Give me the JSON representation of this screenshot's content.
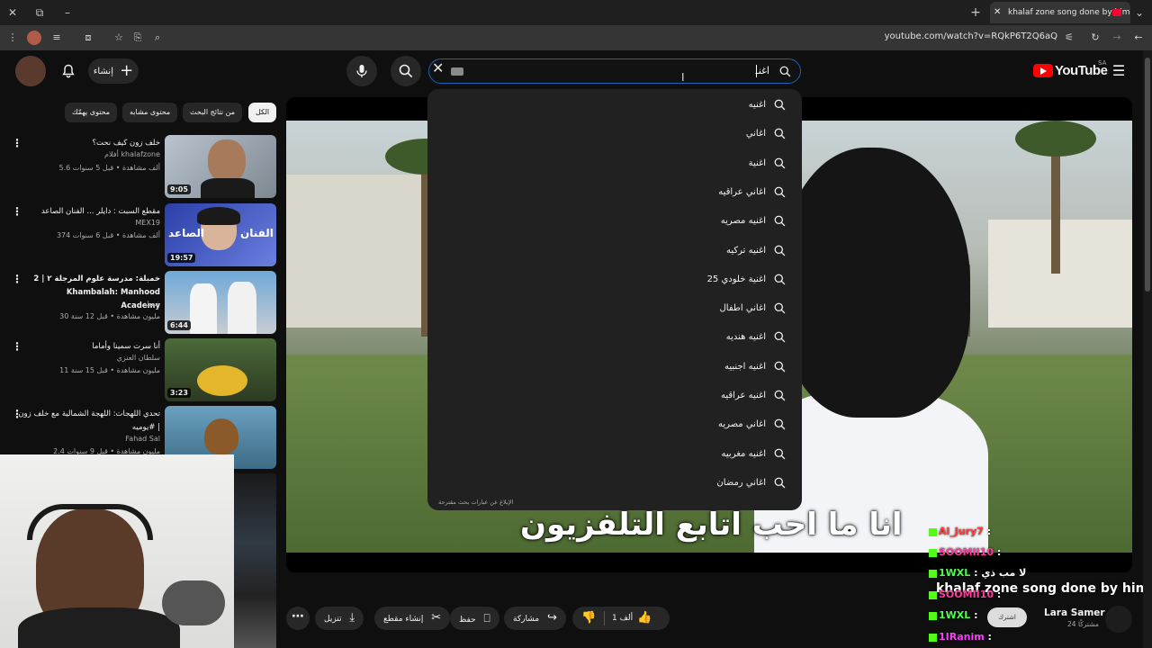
{
  "browser": {
    "active_tab_title": "khalaf zone song done by him",
    "url": "youtube.com/watch?v=RQkP6T2Q6aQ"
  },
  "header": {
    "create_label": "إنشاء",
    "search_query": "اغنـ",
    "logo_text": "YouTube",
    "country_code": "SA"
  },
  "chips": [
    "الكل",
    "من نتائج البحث",
    "محتوى مشابه",
    "محتوى يهمّك"
  ],
  "suggestions": [
    "اغنيه",
    "اغاني",
    "اغنية",
    "اغاني عراقيه",
    "اغنيه مصريه",
    "اغنيه تركيه",
    "اغنية خلودي 25",
    "اغاني اطفال",
    "اغنيه هنديه",
    "اغنيه اجنبيه",
    "اغنيه عراقيه",
    "اغاني مصريه",
    "اغنيه مغربيه",
    "اغاني رمضان"
  ],
  "report_link": "الإبلاغ عن عبارات بحث مقترحة",
  "recommendations": [
    {
      "title": "خلف زون كيف نحت؟",
      "channel": "khalafzone",
      "channel_prefix": "أفلام",
      "meta": "5.6 ألف مشاهدة • قبل 5 سنوات",
      "duration": "9:05"
    },
    {
      "title": "مقطع السبت : دايلر ... الفنان الصاعد",
      "channel": "MEX19",
      "meta": "374 ألف مشاهدة • قبل 6 سنوات",
      "duration": "19:57"
    },
    {
      "title": "خمبلة: مدرسة علوم المرجلة ٢ | 2 Khambalah: Manhood Academy",
      "channel": "خمبلة",
      "meta": "30 مليون مشاهدة • قبل 12 سنة",
      "duration": "6:44"
    },
    {
      "title": "أنا سرت سمينا وأماما",
      "channel": "سلطان العنزي",
      "meta": "11 مليون مشاهدة • قبل 15 سنة",
      "duration": "3:23"
    },
    {
      "title": "تحدي اللهجات: اللهجة الشمالية مع خلف زون | #يوميه",
      "channel": "Fahad Sal",
      "meta": "2.4 مليون مشاهدة • قبل 9 سنوات",
      "duration": ""
    }
  ],
  "player": {
    "subtitle": "انا ما احب اتابع التلفزيون"
  },
  "actions": {
    "like_count": "1 ألف",
    "share": "مشاركة",
    "save": "حفظ",
    "clip": "إنشاء مقطع",
    "download": "تنزيل"
  },
  "channel": {
    "name": "Lara Samer",
    "subs": "24 مشتركًا"
  },
  "overlay": {
    "title": "khalaf zone song done by him 😙",
    "chat": [
      {
        "user": "Al_Jury7",
        "text": "",
        "color": "#ff3b3b"
      },
      {
        "user": "SOOMII10",
        "text": "",
        "color": "#ff3b9e"
      },
      {
        "user": "1WXL",
        "text": "لا مب ذي",
        "color": "#4cff4c"
      },
      {
        "user": "SOOMII10",
        "text": "",
        "color": "#ff3b9e"
      },
      {
        "user": "1WXL",
        "text": "",
        "color": "#4cff4c"
      },
      {
        "user": "1IRanim",
        "text": "",
        "color": "#ff3bff"
      }
    ]
  },
  "colors": {
    "background": "#0f0f0f",
    "accent": "#ff0000",
    "search_focus": "#1c62b9",
    "chip_bg": "#272727"
  }
}
